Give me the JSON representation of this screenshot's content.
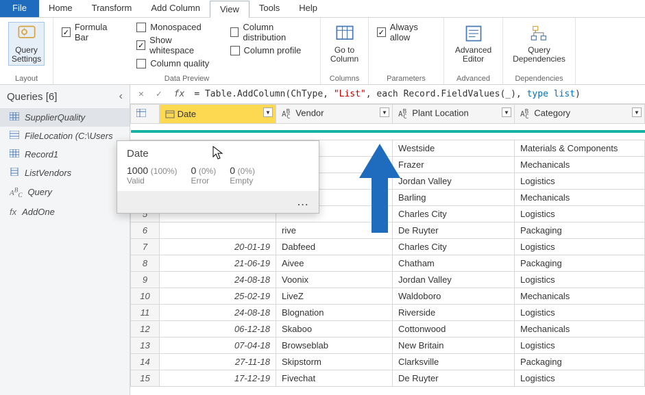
{
  "menu": {
    "file": "File",
    "home": "Home",
    "transform": "Transform",
    "addcol": "Add Column",
    "view": "View",
    "tools": "Tools",
    "help": "Help"
  },
  "ribbon": {
    "query_settings": "Query\nSettings",
    "layout_group": "Layout",
    "formula_bar": "Formula Bar",
    "monospaced": "Monospaced",
    "show_whitespace": "Show whitespace",
    "column_quality": "Column quality",
    "column_distribution": "Column distribution",
    "column_profile": "Column profile",
    "data_preview_group": "Data Preview",
    "goto_column": "Go to\nColumn",
    "columns_group": "Columns",
    "always_allow": "Always allow",
    "parameters_group": "Parameters",
    "advanced_editor": "Advanced\nEditor",
    "advanced_group": "Advanced",
    "query_deps": "Query\nDependencies",
    "deps_group": "Dependencies"
  },
  "sidebar": {
    "title": "Queries [6]",
    "items": [
      "SupplierQuality",
      "FileLocation (C:\\Users",
      "Record1",
      "ListVendors",
      "Query",
      "AddOne"
    ]
  },
  "formula": {
    "fx": "fx",
    "eq": "=",
    "text": " Table.AddColumn(ChType, ",
    "str": "\"List\"",
    "text2": ", each Record.FieldValues(_), ",
    "kw": "type list",
    "text3": ")"
  },
  "columns": [
    {
      "type": "date",
      "label": "Date"
    },
    {
      "type": "abc",
      "label": "Vendor"
    },
    {
      "type": "abc",
      "label": "Plant Location"
    },
    {
      "type": "abc",
      "label": "Category"
    }
  ],
  "rows": [
    {
      "n": 1,
      "date": "",
      "vendor": "ug",
      "plant": "Westside",
      "cat": "Materials & Components"
    },
    {
      "n": 2,
      "date": "",
      "vendor": "m",
      "plant": "Frazer",
      "cat": "Mechanicals"
    },
    {
      "n": 3,
      "date": "",
      "vendor": "at",
      "plant": "Jordan Valley",
      "cat": "Logistics"
    },
    {
      "n": 4,
      "date": "",
      "vendor": "",
      "plant": "Barling",
      "cat": "Mechanicals"
    },
    {
      "n": 5,
      "date": "",
      "vendor": "",
      "plant": "Charles City",
      "cat": "Logistics"
    },
    {
      "n": 6,
      "date": "",
      "vendor": "rive",
      "plant": "De Ruyter",
      "cat": "Packaging"
    },
    {
      "n": 7,
      "date": "20-01-19",
      "vendor": "Dabfeed",
      "plant": "Charles City",
      "cat": "Logistics"
    },
    {
      "n": 8,
      "date": "21-06-19",
      "vendor": "Aivee",
      "plant": "Chatham",
      "cat": "Packaging"
    },
    {
      "n": 9,
      "date": "24-08-18",
      "vendor": "Voonix",
      "plant": "Jordan Valley",
      "cat": "Logistics"
    },
    {
      "n": 10,
      "date": "25-02-19",
      "vendor": "LiveZ",
      "plant": "Waldoboro",
      "cat": "Mechanicals"
    },
    {
      "n": 11,
      "date": "24-08-18",
      "vendor": "Blognation",
      "plant": "Riverside",
      "cat": "Logistics"
    },
    {
      "n": 12,
      "date": "06-12-18",
      "vendor": "Skaboo",
      "plant": "Cottonwood",
      "cat": "Mechanicals"
    },
    {
      "n": 13,
      "date": "07-04-18",
      "vendor": "Browseblab",
      "plant": "New Britain",
      "cat": "Logistics"
    },
    {
      "n": 14,
      "date": "27-11-18",
      "vendor": "Skipstorm",
      "plant": "Clarksville",
      "cat": "Packaging"
    },
    {
      "n": 15,
      "date": "17-12-19",
      "vendor": "Fivechat",
      "plant": "De Ruyter",
      "cat": "Logistics"
    }
  ],
  "tooltip": {
    "title": "Date",
    "valid_n": "1000",
    "valid_p": "(100%)",
    "valid_l": "Valid",
    "error_n": "0",
    "error_p": "(0%)",
    "error_l": "Error",
    "empty_n": "0",
    "empty_p": "(0%)",
    "empty_l": "Empty",
    "more": "..."
  }
}
